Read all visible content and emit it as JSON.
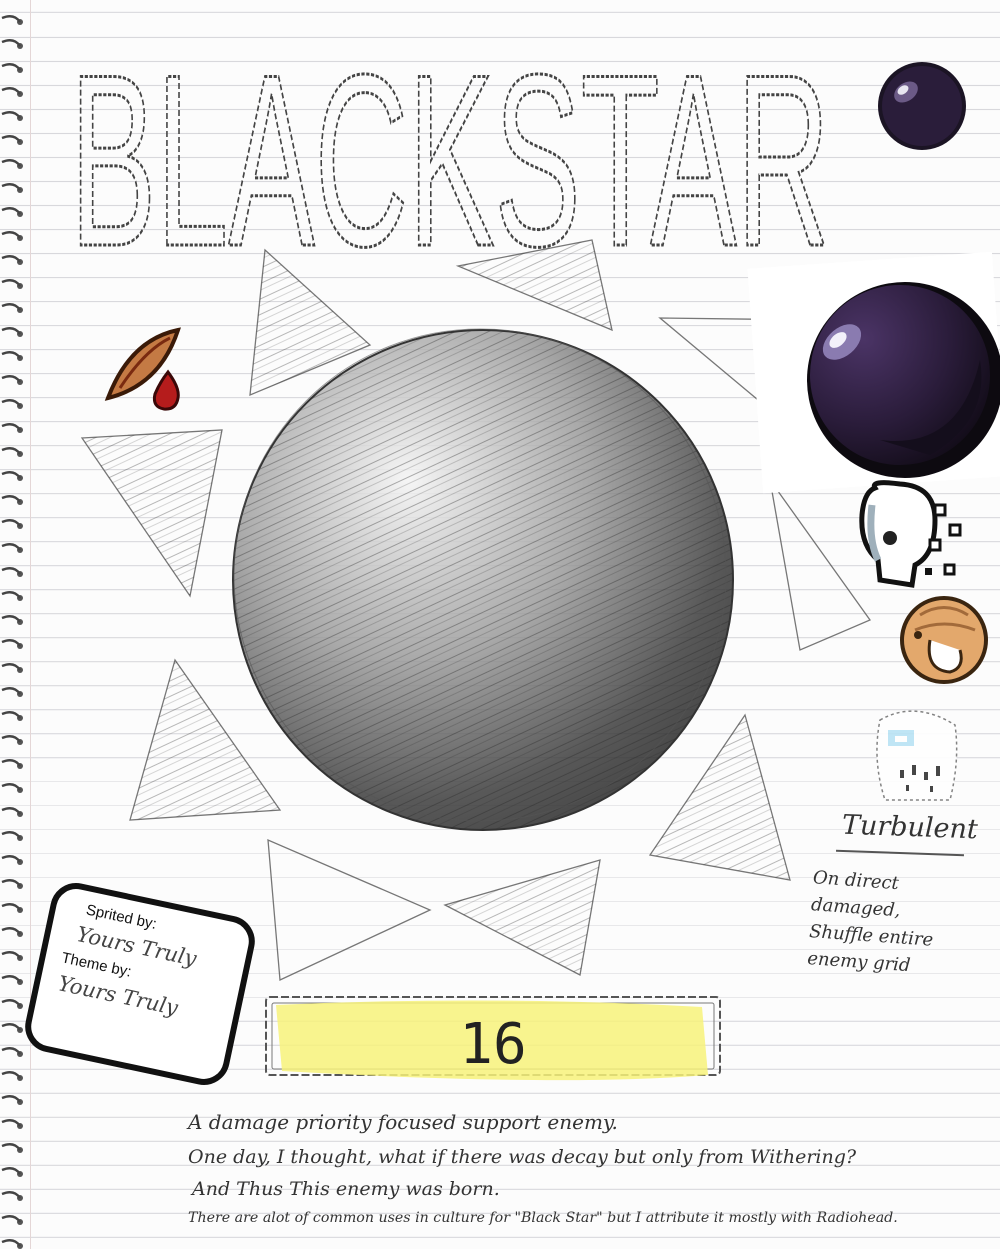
{
  "title": "BLACKSTAR",
  "effect": {
    "name": "Turbulent",
    "description_lines": [
      "On direct",
      "damaged,",
      "Shuffle entire",
      "enemy grid"
    ]
  },
  "credits": {
    "sprite_heading": "Sprited by:",
    "sprite_name": "Yours Truly",
    "theme_heading": "Theme by:",
    "theme_name": "Yours Truly"
  },
  "health_bar": {
    "value": "16"
  },
  "notes": [
    "A damage priority focused support enemy.",
    "One day, I thought, what if there was decay but only from Withering?",
    "And Thus This enemy was born.",
    "There are alot of common uses in culture for \"Black Star\" but I attribute it mostly with Radiohead."
  ],
  "icons": [
    "wound-icon",
    "small-black-orb-icon",
    "large-black-orb-icon",
    "skull-icon",
    "grub-icon",
    "ghost-icon"
  ],
  "colors": {
    "bar_highlight": "#f7f27a",
    "orb_dark": "#1b1424",
    "orb_mid": "#3a2650",
    "blood": "#b51c1c",
    "wound": "#c47a44"
  }
}
